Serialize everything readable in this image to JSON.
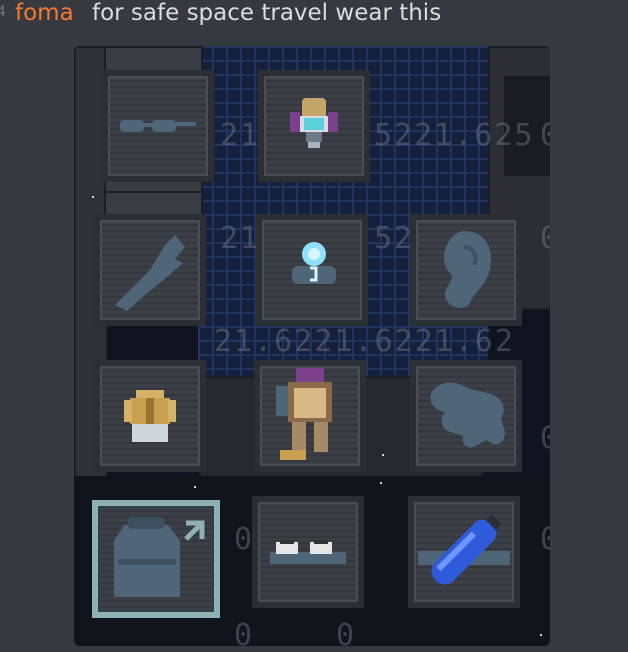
{
  "message": {
    "timestamp_fragment": "4",
    "author": "foma",
    "text": "for safe space travel wear this",
    "author_color": "#f47b30"
  },
  "attachment": {
    "background_numbers": [
      "21.",
      "5221.625",
      "21",
      "52",
      "21.6221.6221.62",
      "0",
      "0",
      "0",
      "0",
      "0",
      "0",
      "0"
    ],
    "slots": [
      {
        "name": "glasses-slot",
        "icon": "glasses-icon"
      },
      {
        "name": "head-slot",
        "icon": "space-helmet-icon"
      },
      {
        "name": "gloves-slot",
        "icon": "glove-icon"
      },
      {
        "name": "mask-slot",
        "icon": "breath-mask-icon"
      },
      {
        "name": "ear-slot",
        "icon": "ear-icon"
      },
      {
        "name": "uniform-slot",
        "icon": "jumpsuit-icon"
      },
      {
        "name": "suit-slot",
        "icon": "hardsuit-icon"
      },
      {
        "name": "hand-slot",
        "icon": "hand-icon"
      },
      {
        "name": "back-slot",
        "icon": "backpack-icon"
      },
      {
        "name": "shoes-slot",
        "icon": "shoes-icon"
      },
      {
        "name": "tank-slot",
        "icon": "oxygen-tank-icon"
      }
    ]
  }
}
